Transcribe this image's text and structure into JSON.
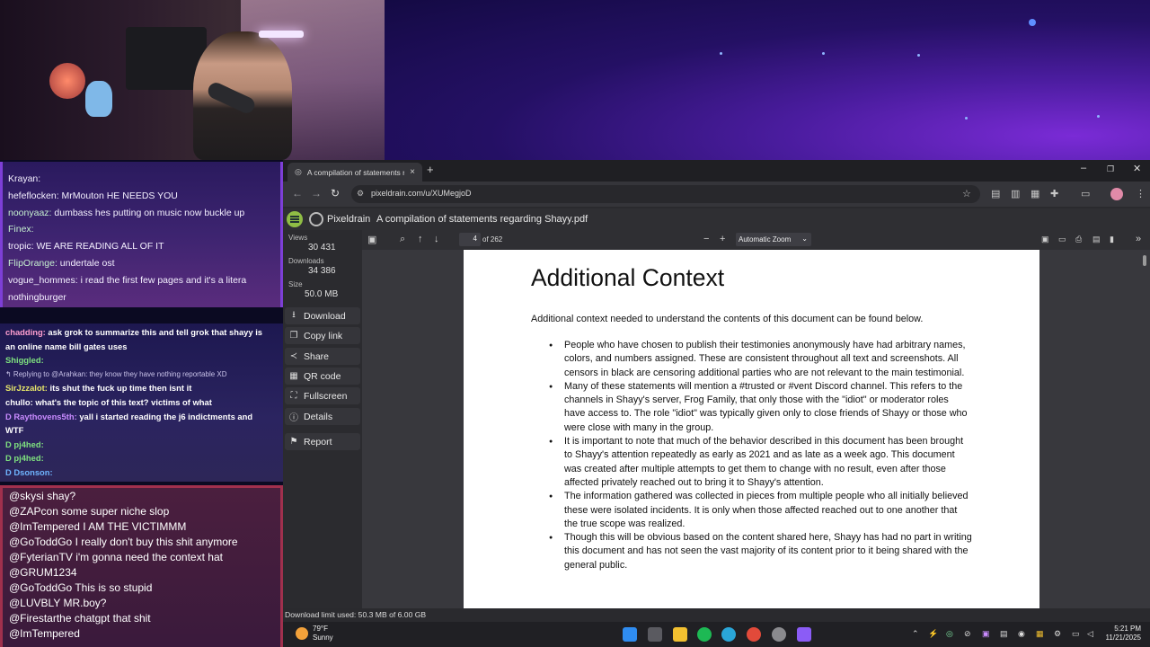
{
  "chat_top": [
    {
      "user": "Krayan:",
      "msg": "",
      "color": "#f4f0ff"
    },
    {
      "user": "hefeflocken:",
      "msg": "MrMouton HE NEEDS YOU",
      "color": "#f4f0ff"
    },
    {
      "user": "noonyaaz:",
      "msg": "dumbass hes putting on music now buckle up",
      "color": "#c6f0d0"
    },
    {
      "user": "Finex:",
      "msg": "",
      "color": "#c6f0d0"
    },
    {
      "user": "tropic:",
      "msg": "WE ARE READING ALL OF IT",
      "color": "#f4f0ff"
    },
    {
      "user": "FlipOrange:",
      "msg": "undertale ost",
      "color": "#c6f0d0"
    },
    {
      "user": "vogue_hommes:",
      "msg": "i read the first few pages and it's a litera",
      "color": "#f4f0ff"
    },
    {
      "user": "",
      "msg": "nothingburger",
      "color": "#f4f0ff"
    }
  ],
  "chat_mid": [
    {
      "user": "chadding:",
      "msg": "ask grok to summarize this and tell grok that shayy is",
      "color": "#ff9fd0",
      "small": false
    },
    {
      "user": "",
      "msg": "an online name bill gates uses",
      "color": "#ffffff",
      "small": false
    },
    {
      "user": "Shiggled:",
      "msg": "",
      "color": "#7fe27f",
      "small": false
    },
    {
      "user": "",
      "msg": "↰ Replying to @Arahkan: they know they have nothing reportable XD",
      "color": "#c8c2e8",
      "small": true
    },
    {
      "user": "SirJzzalot:",
      "msg": "its shut the fuck up time then isnt it",
      "color": "#e6e66a",
      "small": false
    },
    {
      "user": "chullo:",
      "msg": "what's the topic of this text? victims of what",
      "color": "#ffffff",
      "small": false
    },
    {
      "user": "D Raythovens5th:",
      "msg": "yall i started reading the j6 indictments and",
      "color": "#c98bff",
      "small": false
    },
    {
      "user": "",
      "msg": "WTF",
      "color": "#ffffff",
      "small": false
    },
    {
      "user": "D pj4hed:",
      "msg": "",
      "color": "#7fe27f",
      "small": false
    },
    {
      "user": "D pj4hed:",
      "msg": "",
      "color": "#7fe27f",
      "small": false
    },
    {
      "user": "D Dsonson:",
      "msg": "",
      "color": "#6fb5ff",
      "small": false
    }
  ],
  "chat_bottom": [
    {
      "user": "@skysi",
      "msg": "shay?"
    },
    {
      "user": "@ZAPcon",
      "msg": "some super niche slop"
    },
    {
      "user": "@ImTempered",
      "msg": "I AM THE VICTIMMM"
    },
    {
      "user": "@GoToddGo",
      "msg": "I really don't buy this shit anymore"
    },
    {
      "user": "@FyterianTV",
      "msg": "i'm gonna need the context hat"
    },
    {
      "user": "@GRUM1234",
      "msg": ""
    },
    {
      "user": "@GoToddGo",
      "msg": "This is so stupid"
    },
    {
      "user": "@LUVBLY",
      "msg": "MR.boy?"
    },
    {
      "user": "@Firestarthe",
      "msg": "chatgpt that shit"
    },
    {
      "user": "@ImTempered",
      "msg": ""
    }
  ],
  "browser": {
    "tab_title": "A compilation of statements re",
    "url": "pixeldrain.com/u/XUMegjoD",
    "new_tab": "+",
    "min": "–",
    "max": "❐",
    "close": "✕"
  },
  "pixeldrain": {
    "name": "Pixeldrain",
    "file_title": "A compilation of statements regarding Shayy.pdf",
    "views_label": "Views",
    "views": "30 431",
    "downloads_label": "Downloads",
    "downloads": "34 386",
    "size_label": "Size",
    "size": "50.0 MB",
    "buttons": {
      "download": "Download",
      "copy_link": "Copy link",
      "share": "Share",
      "qr": "QR code",
      "fullscreen": "Fullscreen",
      "details": "Details",
      "report": "Report"
    },
    "status": "Download limit used: 50.3 MB of 6.00 GB"
  },
  "viewer": {
    "page": "4",
    "page_total": "of 262",
    "zoom": "Automatic Zoom"
  },
  "document": {
    "heading": "Additional Context",
    "intro": "Additional context needed to understand the contents of this document can be found below.",
    "bullets": [
      "People who have chosen to publish their testimonies anonymously have had arbitrary names, colors, and numbers assigned. These are consistent throughout all text and screenshots. All censors in black are censoring additional parties who are not relevant to the main testimonial.",
      "Many of these statements will mention a #trusted or #vent Discord channel. This refers to the channels in Shayy's server, Frog Family, that only those with the \"idiot\" or moderator roles have access to. The role \"idiot\" was typically given only to close friends of Shayy or those who were close with many in the group.",
      "It is important to note that much of the behavior described in this document has been brought to Shayy's attention repeatedly as early as 2021 and as late as a week ago. This document was created after multiple attempts to get them to change with no result, even after those affected privately reached out to bring it to Shayy's attention.",
      "The information gathered was collected in pieces from multiple people who all initially believed these were isolated incidents. It is only when those affected reached out to one another that the true scope was realized.",
      "Though this will be obvious based on the content shared here, Shayy has had no part in writing this document and has not seen the vast majority of its content prior to it being shared with the general public."
    ]
  },
  "taskbar": {
    "temp": "79°F",
    "weather": "Sunny",
    "time": "5:21 PM",
    "date": "11/21/2025"
  }
}
